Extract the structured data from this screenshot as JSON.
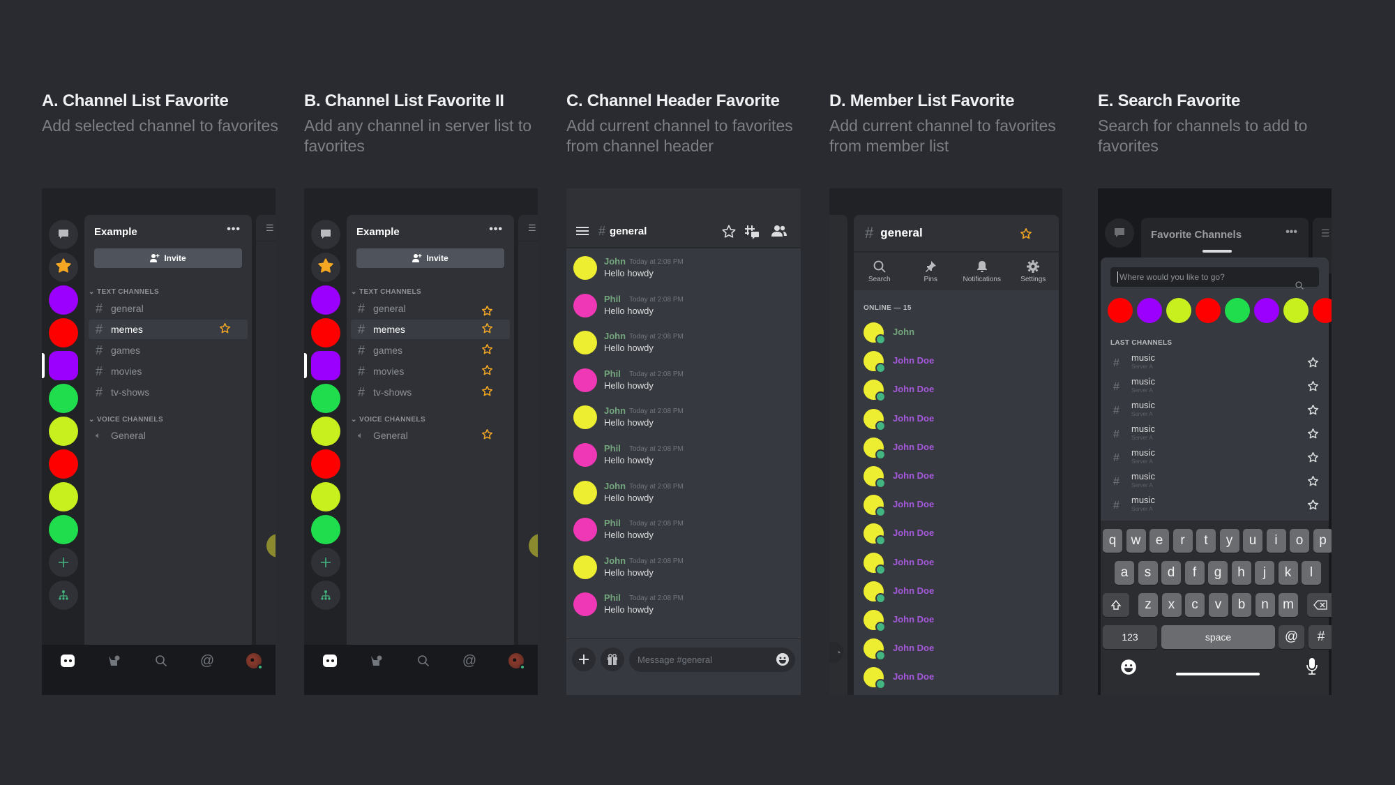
{
  "columns": [
    {
      "title": "A. Channel List Favorite",
      "desc": "Add selected channel to favorites"
    },
    {
      "title": "B. Channel List Favorite II",
      "desc": "Add any channel in server list to favorites"
    },
    {
      "title": "C. Channel Header Favorite",
      "desc": "Add current channel to favorites from channel header"
    },
    {
      "title": "D. Member List Favorite",
      "desc": "Add current channel to favorites from member list"
    },
    {
      "title": "E. Search Favorite",
      "desc": "Search for channels to add to favorites"
    }
  ],
  "colors": {
    "star": "#f5a623",
    "purple": "#9b00ff",
    "red": "#ff0000",
    "green": "#1fdd4c",
    "lime": "#c8f01e",
    "yellow": "#eded32",
    "pink": "#ef38b5",
    "username_green": "#74a67e",
    "username_purple": "#a559dc",
    "online": "#43b581"
  },
  "channel_list": {
    "server_name": "Example",
    "more_label": "•••",
    "invite_label": "Invite",
    "text_category": "TEXT CHANNELS",
    "voice_category": "VOICE CHANNELS",
    "text_channels": [
      "general",
      "memes",
      "games",
      "movies",
      "tv-shows"
    ],
    "selected_channel": "memes",
    "voice_channels": [
      "General"
    ],
    "servers": [
      "dm",
      "favorites",
      "purple",
      "red",
      "purple-selected",
      "green",
      "lime",
      "red",
      "lime",
      "green",
      "add-server",
      "discover"
    ]
  },
  "chat": {
    "channel": "general",
    "messages": [
      {
        "user": "John",
        "time": "Today at 2:08 PM",
        "text": "Hello howdy",
        "avatar": "#eded32"
      },
      {
        "user": "Phil",
        "time": "Today at 2:08 PM",
        "text": "Hello howdy",
        "avatar": "#ef38b5"
      },
      {
        "user": "John",
        "time": "Today at 2:08 PM",
        "text": "Hello howdy",
        "avatar": "#eded32"
      },
      {
        "user": "Phil",
        "time": "Today at 2:08 PM",
        "text": "Hello howdy",
        "avatar": "#ef38b5"
      },
      {
        "user": "John",
        "time": "Today at 2:08 PM",
        "text": "Hello howdy",
        "avatar": "#eded32"
      },
      {
        "user": "Phil",
        "time": "Today at 2:08 PM",
        "text": "Hello howdy",
        "avatar": "#ef38b5"
      },
      {
        "user": "John",
        "time": "Today at 2:08 PM",
        "text": "Hello howdy",
        "avatar": "#eded32"
      },
      {
        "user": "Phil",
        "time": "Today at 2:08 PM",
        "text": "Hello howdy",
        "avatar": "#ef38b5"
      },
      {
        "user": "John",
        "time": "Today at 2:08 PM",
        "text": "Hello howdy",
        "avatar": "#eded32"
      },
      {
        "user": "Phil",
        "time": "Today at 2:08 PM",
        "text": "Hello howdy",
        "avatar": "#ef38b5"
      }
    ],
    "composer_placeholder": "Message #general"
  },
  "members": {
    "channel": "general",
    "actions": [
      "Search",
      "Pins",
      "Notifications",
      "Settings"
    ],
    "online_label": "ONLINE — 15",
    "list": [
      "John",
      "John Doe",
      "John Doe",
      "John Doe",
      "John Doe",
      "John Doe",
      "John Doe",
      "John Doe",
      "John Doe",
      "John Doe",
      "John Doe",
      "John Doe",
      "John Doe"
    ]
  },
  "search": {
    "bg_title": "Favorite Channels",
    "placeholder": "Where would you like to go?",
    "quick_switch_colors": [
      "#ff0000",
      "#9b00ff",
      "#c8f01e",
      "#ff0000",
      "#1fdd4c",
      "#9b00ff",
      "#c8f01e",
      "#ff0000"
    ],
    "last_channels_label": "LAST CHANNELS",
    "last_channels": [
      {
        "name": "music",
        "server": "Server A"
      },
      {
        "name": "music",
        "server": "Server A"
      },
      {
        "name": "music",
        "server": "Server A"
      },
      {
        "name": "music",
        "server": "Server A"
      },
      {
        "name": "music",
        "server": "Server A"
      },
      {
        "name": "music",
        "server": "Server A"
      },
      {
        "name": "music",
        "server": "Server A"
      }
    ],
    "keyboard": {
      "row1": [
        "q",
        "w",
        "e",
        "r",
        "t",
        "y",
        "u",
        "i",
        "o",
        "p"
      ],
      "row2": [
        "a",
        "s",
        "d",
        "f",
        "g",
        "h",
        "j",
        "k",
        "l"
      ],
      "row3": [
        "z",
        "x",
        "c",
        "v",
        "b",
        "n",
        "m"
      ],
      "numbers_label": "123",
      "space_label": "space",
      "at_label": "@",
      "hash_label": "#"
    }
  }
}
